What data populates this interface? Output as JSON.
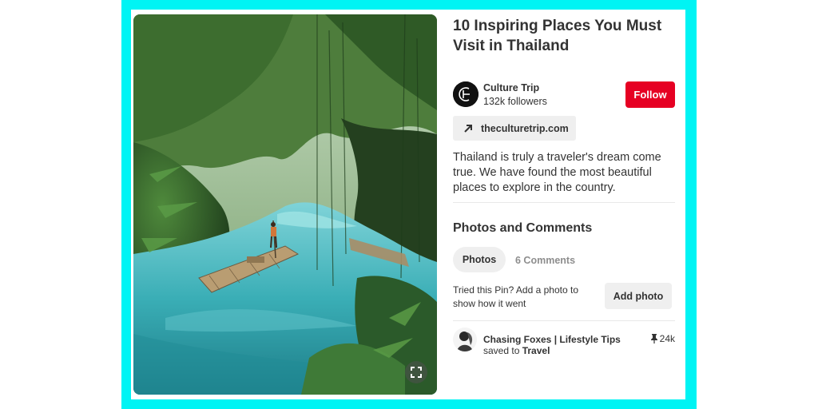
{
  "pin": {
    "title": "10 Inspiring Places You Must Visit in Thailand",
    "image_alt": "Bamboo raft on a turquoise river in a jungle",
    "description": "Thailand is truly a traveler's dream come true. We have found the most beautiful places to explore in the country."
  },
  "creator": {
    "name": "Culture Trip",
    "followers": "132k followers",
    "follow_label": "Follow"
  },
  "link": {
    "label": "theculturetrip.com"
  },
  "photos_comments": {
    "title": "Photos and Comments",
    "tab_photos": "Photos",
    "tab_comments": "6 Comments",
    "tried_text": "Tried this Pin? Add a photo to show how it went",
    "add_photo_label": "Add photo"
  },
  "saver": {
    "name": "Chasing Foxes | Lifestyle Tips",
    "saved_to_prefix": "saved to",
    "board": "Travel",
    "save_count": "24k"
  },
  "colors": {
    "frame": "#00f4f4",
    "follow_red": "#e60023",
    "button_gray": "#efefef"
  }
}
